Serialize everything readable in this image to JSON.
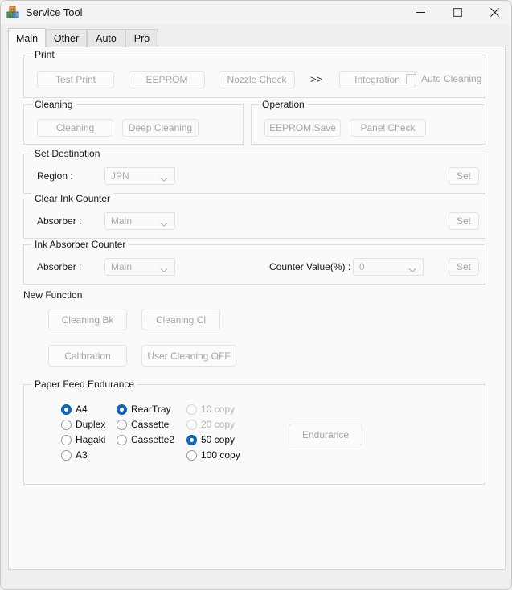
{
  "window": {
    "title": "Service Tool",
    "icon": "blocks-icon",
    "controls": {
      "minimize": "minimize-icon",
      "maximize": "maximize-icon",
      "close": "close-icon"
    }
  },
  "tabs": [
    {
      "label": "Main",
      "active": true
    },
    {
      "label": "Other",
      "active": false
    },
    {
      "label": "Auto",
      "active": false
    },
    {
      "label": "Pro",
      "active": false
    }
  ],
  "groups": {
    "print": {
      "label": "Print",
      "buttons": [
        {
          "label": "Test Print",
          "disabled": true
        },
        {
          "label": "EEPROM",
          "disabled": true
        },
        {
          "label": "Nozzle Check",
          "disabled": true
        },
        {
          "label": "Integration",
          "disabled": true
        }
      ],
      "separator": ">>",
      "checkbox": {
        "label": "Auto Cleaning",
        "checked": false,
        "disabled": true
      }
    },
    "cleaning": {
      "label": "Cleaning",
      "buttons": [
        {
          "label": "Cleaning",
          "disabled": true
        },
        {
          "label": "Deep Cleaning",
          "disabled": true
        }
      ]
    },
    "operation": {
      "label": "Operation",
      "buttons": [
        {
          "label": "EEPROM Save",
          "disabled": true
        },
        {
          "label": "Panel Check",
          "disabled": true
        }
      ]
    },
    "set_destination": {
      "label": "Set Destination",
      "field_label": "Region :",
      "value": "JPN",
      "set_button": "Set"
    },
    "clear_ink_counter": {
      "label": "Clear Ink Counter",
      "field_label": "Absorber :",
      "value": "Main",
      "set_button": "Set"
    },
    "ink_absorber_counter": {
      "label": "Ink Absorber Counter",
      "field_label": "Absorber :",
      "value": "Main",
      "counter_label": "Counter Value(%) :",
      "counter_value": "0",
      "set_button": "Set"
    },
    "new_function": {
      "label": "New Function",
      "buttons": [
        {
          "label": "Cleaning Bk",
          "disabled": true
        },
        {
          "label": "Cleaning Cl",
          "disabled": true
        },
        {
          "label": "Calibration",
          "disabled": true
        },
        {
          "label": "User Cleaning OFF",
          "disabled": true
        }
      ]
    },
    "paper_feed_endurance": {
      "label": "Paper Feed Endurance",
      "paper_sizes": [
        {
          "label": "A4",
          "checked": true,
          "disabled": false
        },
        {
          "label": "Duplex",
          "checked": false,
          "disabled": false
        },
        {
          "label": "Hagaki",
          "checked": false,
          "disabled": false
        },
        {
          "label": "A3",
          "checked": false,
          "disabled": false
        }
      ],
      "sources": [
        {
          "label": "RearTray",
          "checked": true,
          "disabled": false
        },
        {
          "label": "Cassette",
          "checked": false,
          "disabled": false
        },
        {
          "label": "Cassette2",
          "checked": false,
          "disabled": false
        }
      ],
      "copies": [
        {
          "label": "10 copy",
          "checked": false,
          "disabled": true
        },
        {
          "label": "20 copy",
          "checked": false,
          "disabled": true
        },
        {
          "label": "50 copy",
          "checked": true,
          "disabled": false
        },
        {
          "label": "100 copy",
          "checked": false,
          "disabled": false
        }
      ],
      "endurance_button": {
        "label": "Endurance",
        "disabled": true
      }
    }
  },
  "colors": {
    "accent": "#0f6cbd",
    "window_bg": "#efefef",
    "page_bg": "#fafafa",
    "disabled_text": "#a6a6a6"
  }
}
